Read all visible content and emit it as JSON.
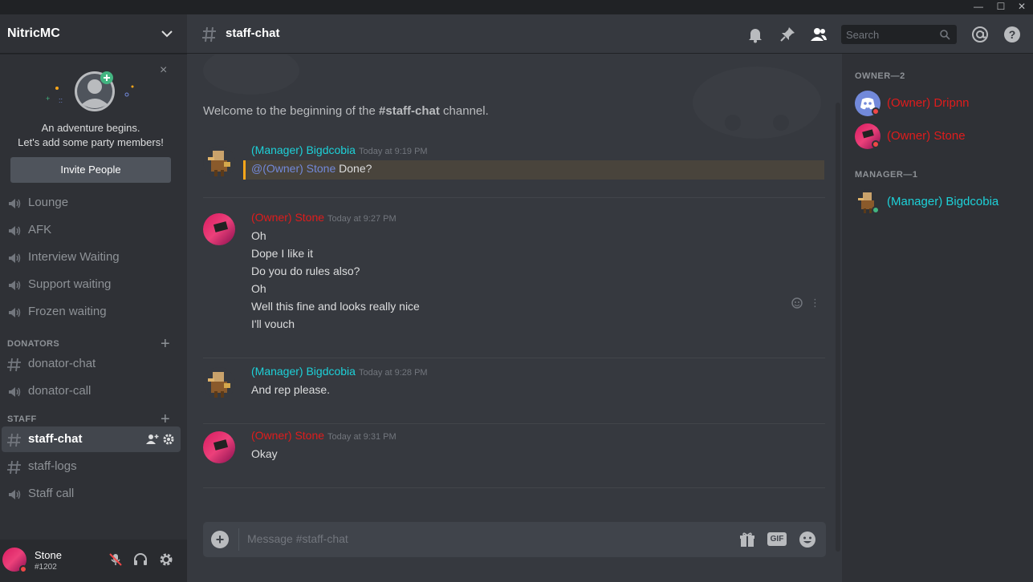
{
  "server": {
    "name": "NitricMC"
  },
  "invite": {
    "title": "An adventure begins.",
    "subtitle": "Let's add some party members!",
    "button": "Invite People",
    "close": "×"
  },
  "channels": {
    "voice": [
      {
        "label": "Lounge"
      },
      {
        "label": "AFK"
      },
      {
        "label": "Interview Waiting"
      },
      {
        "label": "Support waiting"
      },
      {
        "label": "Frozen waiting"
      }
    ],
    "categories": [
      {
        "name": "DONATORS",
        "channels": [
          {
            "label": "donator-chat",
            "type": "text"
          },
          {
            "label": "donator-call",
            "type": "voice"
          }
        ]
      },
      {
        "name": "STAFF",
        "channels": [
          {
            "label": "staff-chat",
            "type": "text"
          },
          {
            "label": "staff-logs",
            "type": "text"
          },
          {
            "label": "Staff call",
            "type": "voice"
          }
        ]
      }
    ]
  },
  "user": {
    "name": "Stone",
    "tag": "#1202"
  },
  "header": {
    "channel": "staff-chat",
    "search_placeholder": "Search"
  },
  "welcome": {
    "prefix": "Welcome to the beginning of the ",
    "channel": "#staff-chat",
    "suffix": " channel."
  },
  "messages": [
    {
      "author": "(Manager) Bigdcobia",
      "role": "manager",
      "time": "Today at 9:19 PM",
      "mention": "@(Owner) Stone",
      "lines": [
        "Done?"
      ]
    },
    {
      "author": "(Owner) Stone",
      "role": "owner",
      "time": "Today at 9:27 PM",
      "lines": [
        "Oh",
        "Dope I like it",
        "Do you do rules also?",
        "Oh",
        "Well this fine and looks really nice",
        "I'll vouch"
      ]
    },
    {
      "author": "(Manager) Bigdcobia",
      "role": "manager",
      "time": "Today at 9:28 PM",
      "lines": [
        "And rep please."
      ]
    },
    {
      "author": "(Owner) Stone",
      "role": "owner",
      "time": "Today at 9:31 PM",
      "lines": [
        "Okay"
      ]
    }
  ],
  "composer": {
    "placeholder": "Message #staff-chat",
    "gif": "GIF"
  },
  "members": {
    "groups": [
      {
        "title": "OWNER—2",
        "members": [
          {
            "name": "(Owner) Dripnn",
            "role": "owner"
          },
          {
            "name": "(Owner) Stone",
            "role": "owner"
          }
        ]
      },
      {
        "title": "MANAGER—1",
        "members": [
          {
            "name": "(Manager) Bigdcobia",
            "role": "manager"
          }
        ]
      }
    ]
  },
  "colors": {
    "owner": "#e01c1c",
    "manager": "#1dd1d8",
    "mention": "#7289da",
    "online": "#43b581",
    "dnd": "#f04747",
    "blurple": "#7289da"
  }
}
